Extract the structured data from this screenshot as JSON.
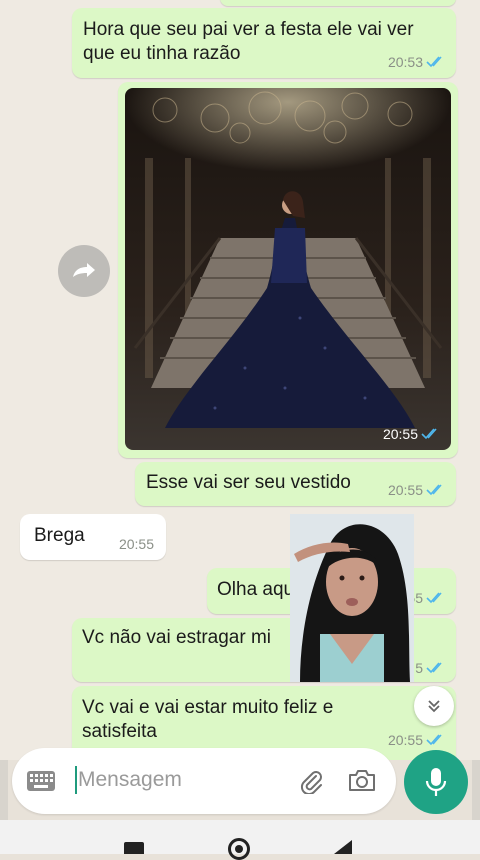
{
  "messages": [
    {
      "id": "m1",
      "text": "Hora que seu pai ver a festa ele vai ver\nque eu tinha razão",
      "time": "20:53",
      "direction": "out"
    },
    {
      "id": "m2",
      "type": "image",
      "time": "20:55",
      "direction": "out"
    },
    {
      "id": "m3",
      "text": "Esse vai ser seu vestido",
      "time": "20:55",
      "direction": "out"
    },
    {
      "id": "m4",
      "text": "Brega",
      "time": "20:55",
      "direction": "in"
    },
    {
      "id": "m5",
      "text": "Olha aqui",
      "time": "20:55",
      "direction": "out"
    },
    {
      "id": "m6",
      "text": "Vc não vai estragar mi",
      "time": "20:55",
      "direction": "out"
    },
    {
      "id": "m7",
      "text": "Vc vai e vai estar muito feliz e\nsatisfeita",
      "time": "20:55",
      "direction": "out"
    }
  ],
  "m6_time_partial": "5",
  "m5_time_partial": "20:55",
  "input": {
    "placeholder": "Mensagem"
  },
  "colors": {
    "outgoing": "#dcf8c6",
    "incoming": "#ffffff",
    "accent": "#1fa385",
    "ticks": "#4fb6ec"
  },
  "icons": {
    "forward": "forward-icon",
    "emoji": "keyboard-icon",
    "attach": "paperclip-icon",
    "camera": "camera-icon",
    "mic": "mic-icon",
    "scroll": "double-chevron-down-icon"
  }
}
